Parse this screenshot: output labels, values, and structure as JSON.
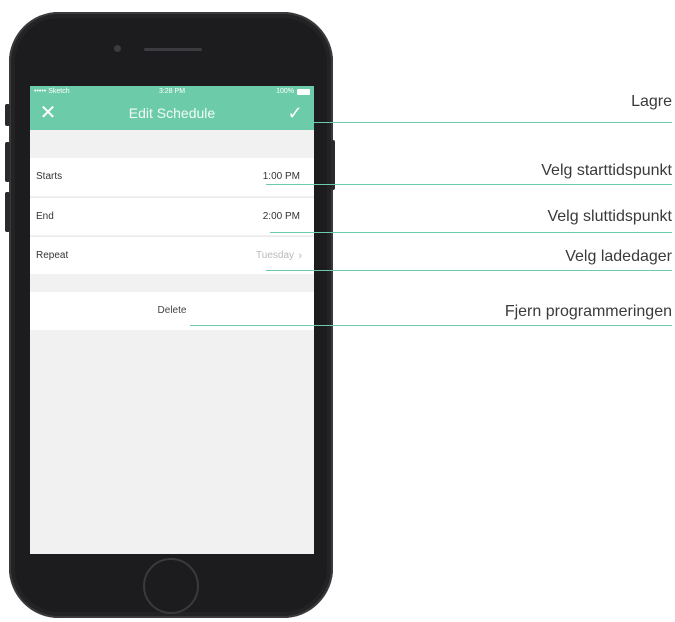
{
  "status_bar": {
    "carrier": "••••• Sketch",
    "time": "3:28 PM",
    "battery": "100%"
  },
  "header": {
    "title": "Edit Schedule",
    "close_icon": "close-icon",
    "save_icon": "checkmark-icon"
  },
  "schedule": {
    "starts_label": "Starts",
    "starts_value": "1:00 PM",
    "end_label": "End",
    "end_value": "2:00 PM",
    "repeat_label": "Repeat",
    "repeat_value": "Tuesday",
    "delete_label": "Delete"
  },
  "callouts": {
    "save": "Lagre",
    "start_time": "Velg starttidspunkt",
    "end_time": "Velg sluttidspunkt",
    "charge_days": "Velg ladedager",
    "remove": "Fjern programmeringen"
  },
  "colors": {
    "accent": "#6ccca9",
    "phone_body": "#1c1c1e",
    "screen_bg": "#f1f1f1"
  }
}
